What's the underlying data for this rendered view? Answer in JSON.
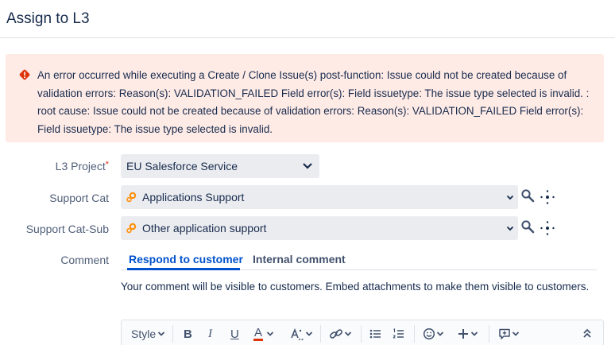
{
  "dialog": {
    "title": "Assign to L3"
  },
  "error": {
    "message": "An error occurred while executing a Create / Clone Issue(s) post-function: Issue could not be created because of validation errors: Reason(s): VALIDATION_FAILED Field error(s): Field issuetype: The issue type selected is invalid. : root cause: Issue could not be created because of validation errors: Reason(s): VALIDATION_FAILED Field error(s): Field issuetype: The issue type selected is invalid.",
    "icon": "error-icon",
    "color": "#de350b"
  },
  "fields": {
    "project": {
      "label": "L3 Project",
      "required_mark": "*",
      "value": "EU Salesforce Service"
    },
    "support_cat": {
      "label": "Support Cat",
      "value": "Applications Support"
    },
    "support_cat_sub": {
      "label": "Support Cat-Sub",
      "value": "Other application support"
    }
  },
  "comment": {
    "label": "Comment",
    "tabs": [
      {
        "label": "Respond to customer",
        "active": true
      },
      {
        "label": "Internal comment",
        "active": false
      }
    ],
    "note": "Your comment will be visible to customers. Embed attachments to make them visible to customers."
  },
  "toolbar": {
    "style_label": "Style",
    "bold_label": "B",
    "italic_label": "I",
    "underline_label": "U",
    "text_color_label": "A",
    "text_color_accent": "#de350b",
    "icons": [
      "text-format-icon",
      "link-icon",
      "bullet-list-icon",
      "numbered-list-icon",
      "emoji-icon",
      "plus-icon",
      "comment-add-icon",
      "collapse-icon"
    ]
  },
  "colors": {
    "accent": "#0052cc",
    "error_bg": "#ffebe6",
    "required": "#de350b",
    "gear": "#ff8b00"
  }
}
